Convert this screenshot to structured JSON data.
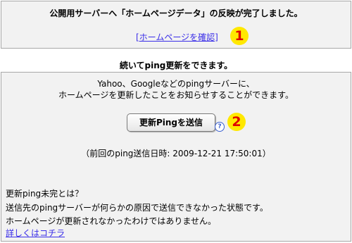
{
  "top": {
    "message": "公開用サーバーへ「ホームページデータ」の反映が完了しました。",
    "link": "[ホームページを確認]",
    "badge": "1"
  },
  "middle": {
    "heading": "続いてping更新をできます。"
  },
  "panel": {
    "desc_line1": "Yahoo、Googleなどのpingサーバーに、",
    "desc_line2": "ホームページを更新したことをお知らせすることができます。",
    "send_button": "更新Pingを送信",
    "help_icon": "?",
    "badge": "2",
    "last_sent": "（前回のping送信日時: 2009-12-21 17:50:01）",
    "note_title": "更新ping未完とは？",
    "note_line1": "送信先のpingサーバーが何らかの原因で送信できなかった状態です。",
    "note_line2": "ホームページが更新されなかったわけではありません。",
    "more_link": "詳しくはコチラ"
  },
  "colors": {
    "panel_bg": "#f2f2f2",
    "link": "#3a2ee8",
    "badge_bg": "#ffe800",
    "badge_text": "#e00000"
  }
}
